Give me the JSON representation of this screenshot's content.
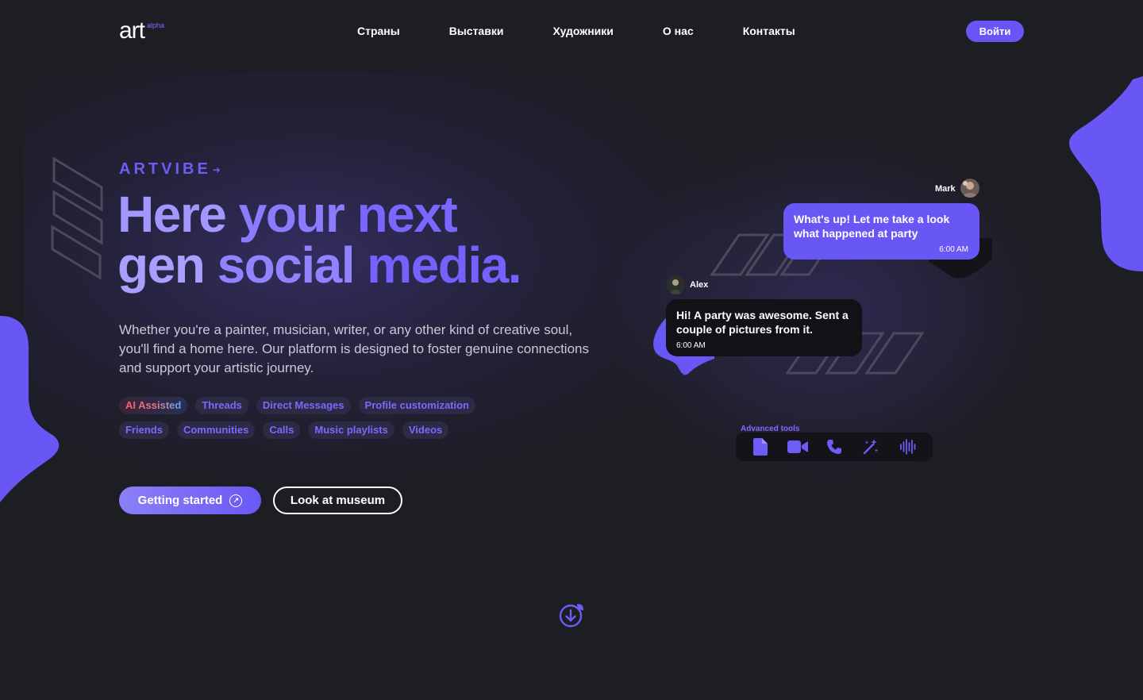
{
  "header": {
    "logo": "art",
    "logo_badge": "alpha",
    "nav": [
      "Страны",
      "Выставки",
      "Художники",
      "О нас",
      "Контакты"
    ],
    "login_label": "Войти"
  },
  "hero": {
    "eyebrow": "ARTVIBE",
    "headline_line1": [
      "Here ",
      "your ",
      "next"
    ],
    "headline_line2": [
      "gen ",
      "social ",
      "media."
    ],
    "lead": "Whether you're a painter, musician, writer, or any other kind of creative soul, you'll find a home here. Our platform is designed to foster genuine connections and support your artistic journey.",
    "tags": [
      "AI Assisted",
      "Threads",
      "Direct Messages",
      "Profile customization",
      "Friends",
      "Communities",
      "Calls",
      "Music playlists",
      "Videos"
    ],
    "cta_primary": "Getting started",
    "cta_secondary": "Look at museum"
  },
  "chat": {
    "mark": {
      "name": "Mark",
      "message": "What's up! Let me take a look what happened at party",
      "time": "6:00 AM"
    },
    "alex": {
      "name": "Alex",
      "message": "Hi! A party was awesome. Sent a couple of pictures from it.",
      "time": "6:00 AM"
    },
    "tools_label": "Advanced tools",
    "tools": [
      "file-icon",
      "video-camera-icon",
      "phone-icon",
      "magic-wand-icon",
      "audio-wave-icon"
    ]
  },
  "colors": {
    "background": "#1d1d24",
    "accent": "#6756f5",
    "tag_background": "#2c2a44"
  }
}
